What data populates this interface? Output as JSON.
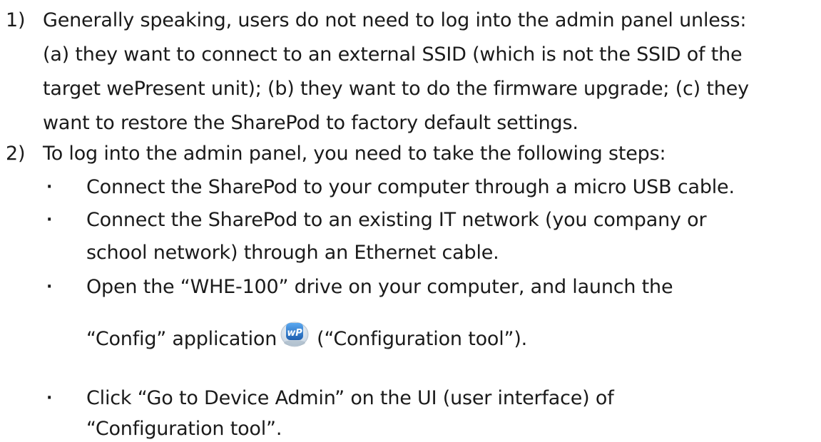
{
  "item1": {
    "number": "1)",
    "lines": [
      "Generally speaking, users do not need to log into the admin panel unless:",
      "(a) they want to connect to an external SSID (which is not the SSID of the",
      "target wePresent unit); (b) they want to do the firmware upgrade; (c) they",
      "want to restore the SharePod to factory default settings."
    ]
  },
  "item2": {
    "number": "2)",
    "line": "To log into the admin panel, you need to take the following steps:"
  },
  "bullets": {
    "symbol": "·",
    "b1": "Connect the SharePod to your computer through a micro USB cable.",
    "b2_line1": "Connect the SharePod to an existing IT network (you company or",
    "b2_line2": "school network) through an Ethernet cable.",
    "b3_line1": "Open the “WHE-100” drive on your computer, and launch the",
    "b3_line2_before": "“Config” application",
    "b3_line2_after": "(“Configuration tool”).",
    "b4_line1": "Click “Go to Device Admin” on the UI (user interface) of",
    "b4_line2": "“Configuration tool”."
  },
  "icon": {
    "name": "wepresent-config-app-icon",
    "text": "wP",
    "color": "#2f7fd0"
  }
}
